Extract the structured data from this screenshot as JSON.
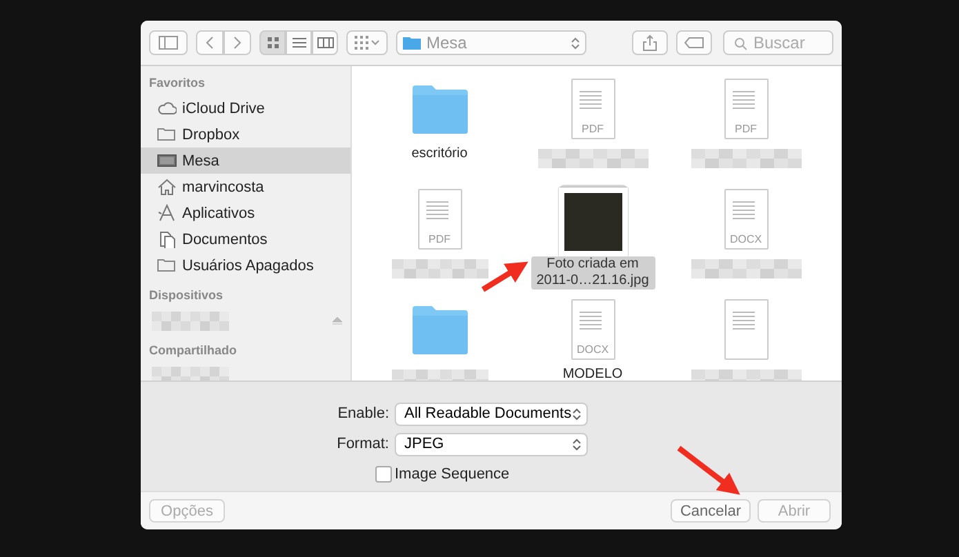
{
  "toolbar": {
    "view_modes": [
      {
        "kind": "icons",
        "selected": true
      },
      {
        "kind": "list",
        "selected": false
      },
      {
        "kind": "columns",
        "selected": false
      }
    ],
    "location": "Mesa",
    "search": {
      "placeholder": "Buscar"
    }
  },
  "sidebar": {
    "sections": [
      {
        "title": "Favoritos",
        "items": [
          {
            "kind": "cloud",
            "label": "iCloud Drive",
            "selected": false
          },
          {
            "kind": "folder",
            "label": "Dropbox",
            "selected": false
          },
          {
            "kind": "desktop",
            "label": "Mesa",
            "selected": true
          },
          {
            "kind": "home",
            "label": "marvincosta",
            "selected": false
          },
          {
            "kind": "apps",
            "label": "Aplicativos",
            "selected": false
          },
          {
            "kind": "documents",
            "label": "Documentos",
            "selected": false
          },
          {
            "kind": "folder",
            "label": "Usuários Apagados",
            "selected": false
          }
        ]
      },
      {
        "title": "Dispositivos",
        "items": [
          {
            "kind": "blurred",
            "eject": true,
            "selected": false
          }
        ]
      },
      {
        "title": "Compartilhado",
        "items": [
          {
            "kind": "blurred",
            "eject": false,
            "selected": false
          }
        ]
      }
    ]
  },
  "files": [
    {
      "kind": "folder",
      "name": "escritório",
      "selected": false
    },
    {
      "kind": "document",
      "type": "PDF",
      "selected": false
    },
    {
      "kind": "document",
      "type": "PDF",
      "selected": false
    },
    {
      "kind": "document",
      "type": "PDF",
      "selected": false
    },
    {
      "kind": "image",
      "name": "Foto criada em 2011-0…21.16.jpg",
      "selected": true
    },
    {
      "kind": "document",
      "type": "DOCX",
      "selected": false
    },
    {
      "kind": "folder",
      "selected": false
    },
    {
      "kind": "document",
      "type": "DOCX",
      "name": "MODELO",
      "selected": false
    },
    {
      "kind": "document",
      "selected": false
    }
  ],
  "options": {
    "enable": {
      "label": "Enable:",
      "value": "All Readable Documents"
    },
    "format": {
      "label": "Format:",
      "value": "JPEG"
    },
    "image_sequence": {
      "label": "Image Sequence",
      "checked": false
    }
  },
  "buttons": [
    {
      "label": "Opções",
      "disabled": true
    },
    {
      "label": "Cancelar",
      "disabled": false
    },
    {
      "label": "Abrir",
      "disabled": true
    }
  ]
}
